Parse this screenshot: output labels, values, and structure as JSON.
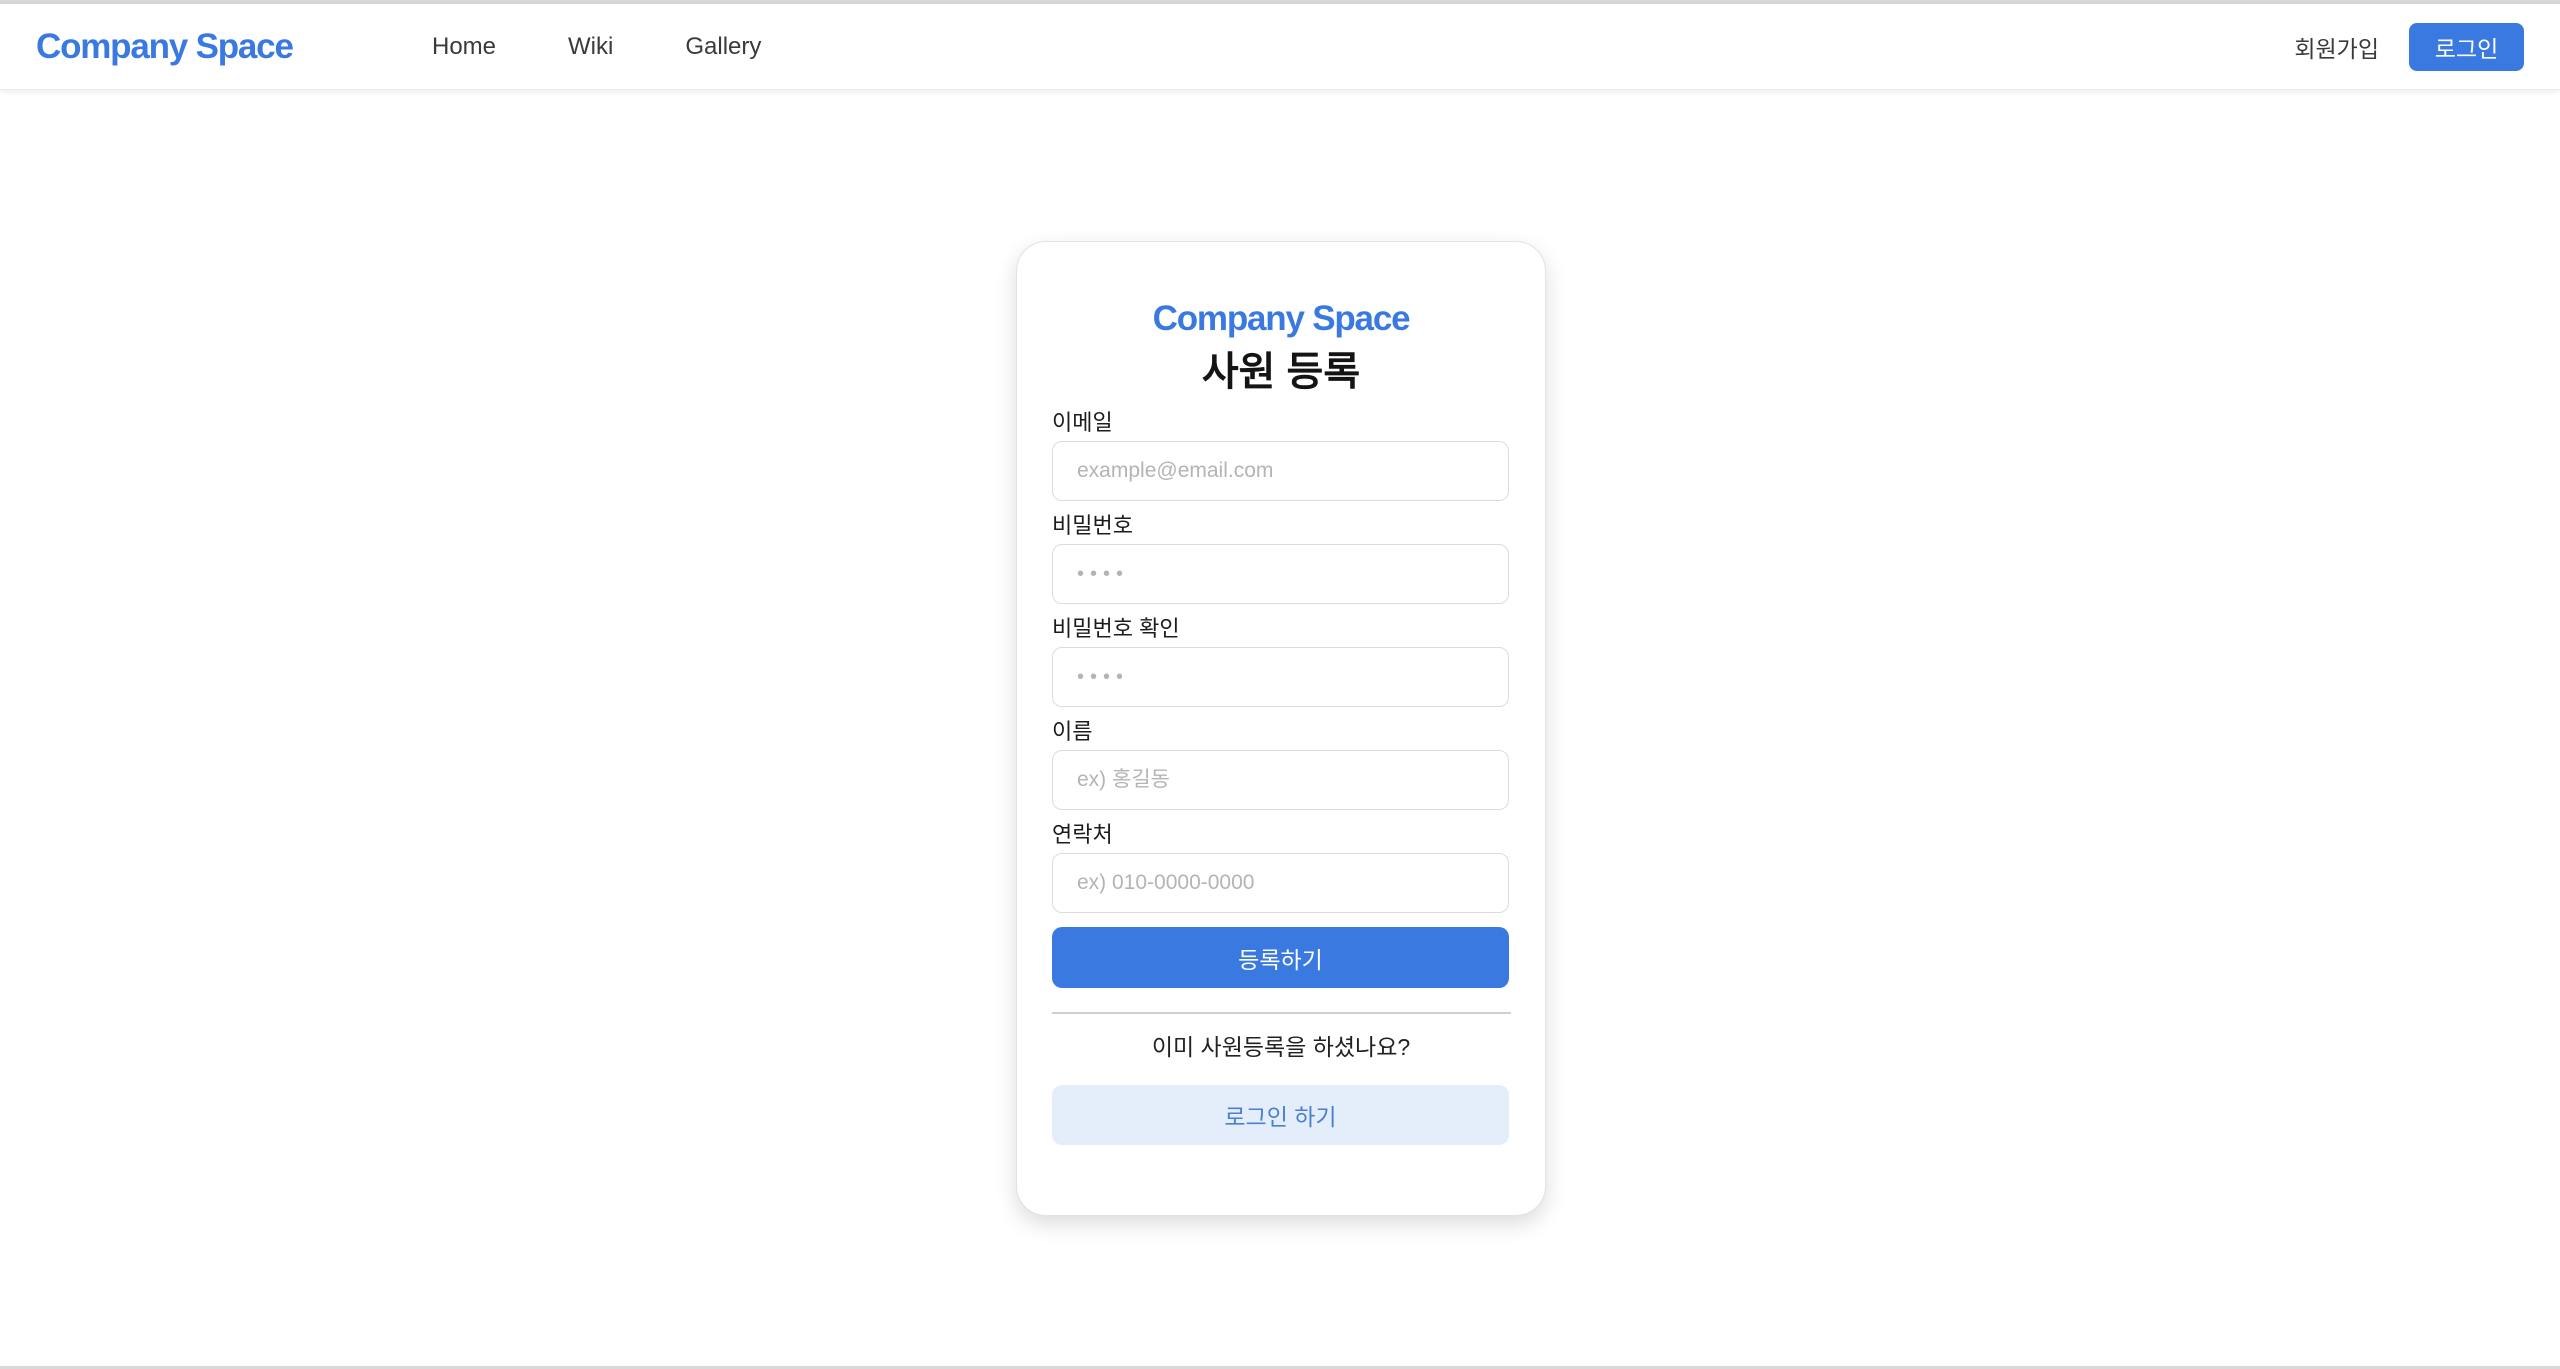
{
  "colors": {
    "accent": "#3a7ae0",
    "accent_soft": "#e4eefb",
    "accent_soft_text": "#4b7fcf"
  },
  "header": {
    "brand": "Company Space",
    "nav": [
      {
        "label": "Home"
      },
      {
        "label": "Wiki"
      },
      {
        "label": "Gallery"
      }
    ],
    "signup_label": "회원가입",
    "login_label": "로그인"
  },
  "card": {
    "brand": "Company Space",
    "title": "사원 등록",
    "fields": [
      {
        "label": "이메일",
        "placeholder": "example@email.com",
        "value": ""
      },
      {
        "label": "비밀번호",
        "placeholder": "••••",
        "value": ""
      },
      {
        "label": "비밀번호 확인",
        "placeholder": "••••",
        "value": ""
      },
      {
        "label": "이름",
        "placeholder": "ex) 홍길동",
        "value": ""
      },
      {
        "label": "연락처",
        "placeholder": "ex) 010-0000-0000",
        "value": ""
      }
    ],
    "submit_label": "등록하기",
    "already_text": "이미 사원등록을 하셨나요?",
    "login_link_label": "로그인 하기"
  }
}
